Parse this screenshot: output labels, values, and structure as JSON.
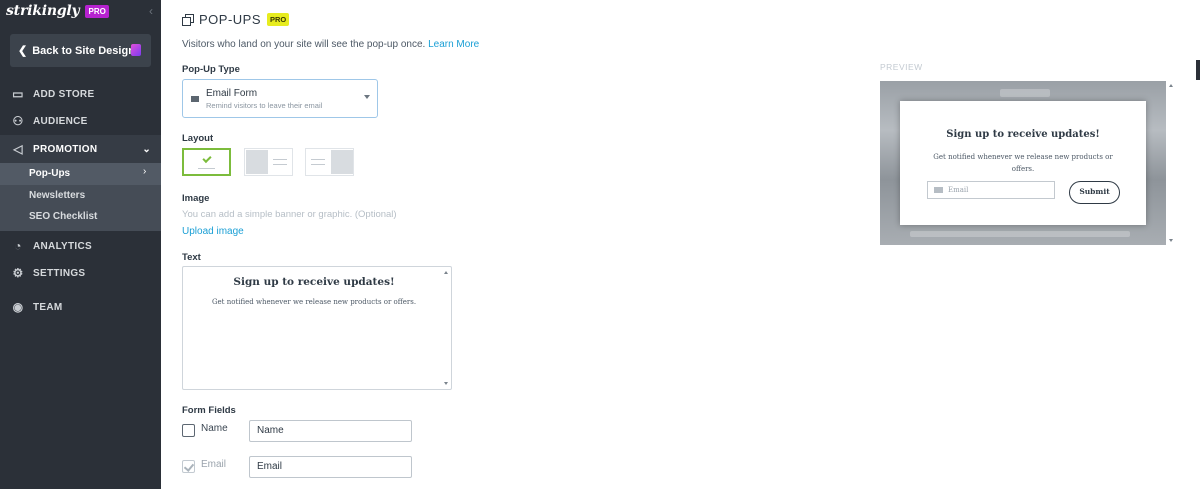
{
  "sidebar": {
    "brand": "strikingly",
    "brand_badge": "PRO",
    "back_label": "Back to Site Design",
    "nav": [
      {
        "label": "ADD STORE",
        "icon": "store-icon"
      },
      {
        "label": "AUDIENCE",
        "icon": "audience-icon"
      },
      {
        "label": "PROMOTION",
        "icon": "megaphone-icon"
      },
      {
        "label": "ANALYTICS",
        "icon": "analytics-icon"
      },
      {
        "label": "SETTINGS",
        "icon": "gear-icon"
      },
      {
        "label": "TEAM",
        "icon": "team-icon"
      }
    ],
    "sub_items": [
      "Pop-Ups",
      "Newsletters",
      "SEO Checklist"
    ]
  },
  "main": {
    "title": "POP-UPS",
    "title_badge": "PRO",
    "description": "Visitors who land on your site will see the pop-up once.",
    "learn_more": "Learn More",
    "popup_type_label": "Pop-Up Type",
    "popup_type_value": "Email Form",
    "popup_type_hint": "Remind visitors to leave their email",
    "layout_label": "Layout",
    "image_label": "Image",
    "image_hint": "You can add a simple banner or graphic. (Optional)",
    "upload_label": "Upload image",
    "text_label": "Text",
    "text_title": "Sign up to receive updates!",
    "text_sub": "Get notified whenever we release new products or offers.",
    "form_fields_label": "Form Fields",
    "fields": [
      {
        "label": "Name",
        "value": "Name",
        "checked": false
      },
      {
        "label": "Email",
        "value": "Email",
        "checked": true
      }
    ]
  },
  "preview": {
    "label": "PREVIEW",
    "title": "Sign up to receive updates!",
    "sub": "Get notified whenever we release new products or offers.",
    "email_placeholder": "Email",
    "submit": "Submit"
  }
}
